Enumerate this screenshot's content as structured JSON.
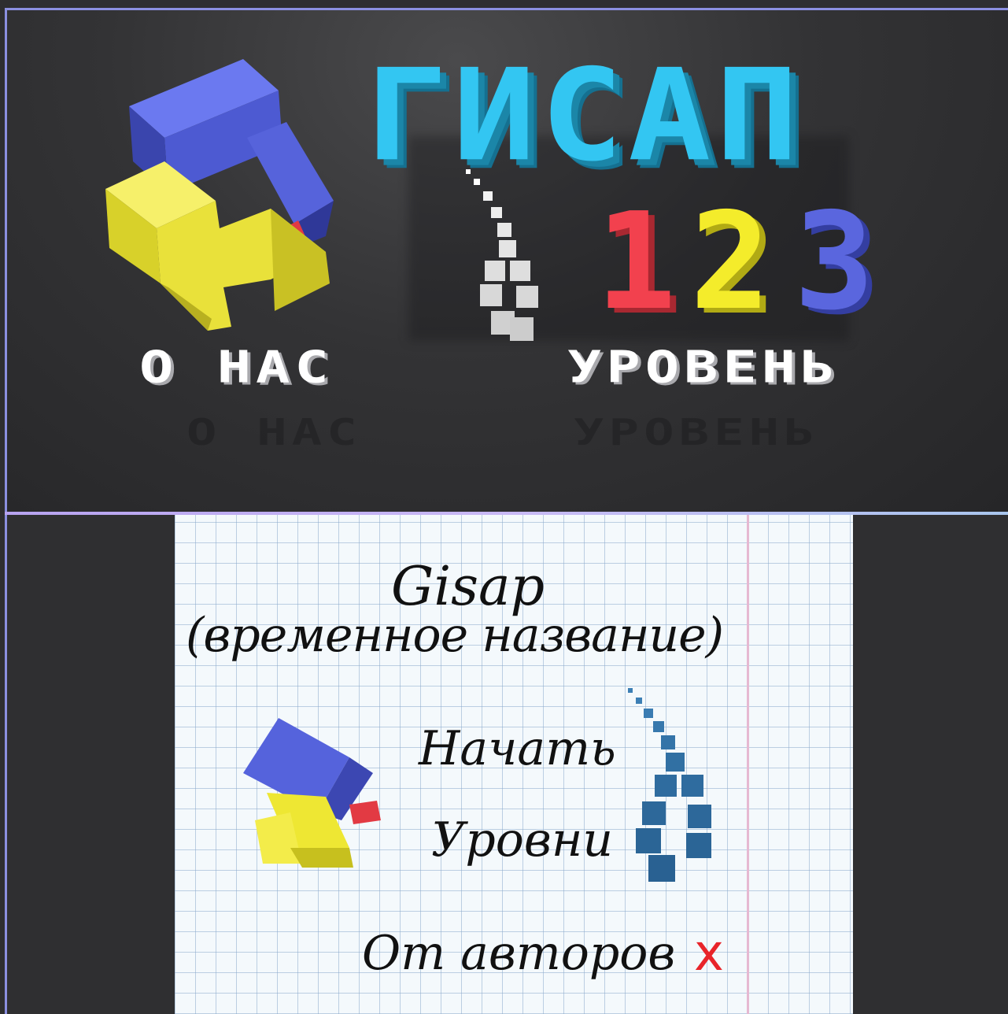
{
  "main_menu": {
    "title": "ГИСАП",
    "level_digits": [
      "1",
      "2",
      "3"
    ],
    "about_label": "О НАС",
    "levels_label": "УРОВЕНЬ",
    "colors": {
      "title": "#33c6f2",
      "digit_1": "#f2414e",
      "digit_2": "#f4ec2b",
      "digit_3": "#5560d8"
    }
  },
  "notebook_menu": {
    "title_line1": "Gisap",
    "title_line2": "(временное название)",
    "start_label": "Начать",
    "levels_label": "Уровни",
    "authors_label": "От авторов",
    "close_symbol": "x",
    "colors": {
      "close": "#e8242a",
      "ink": "#111111"
    }
  }
}
